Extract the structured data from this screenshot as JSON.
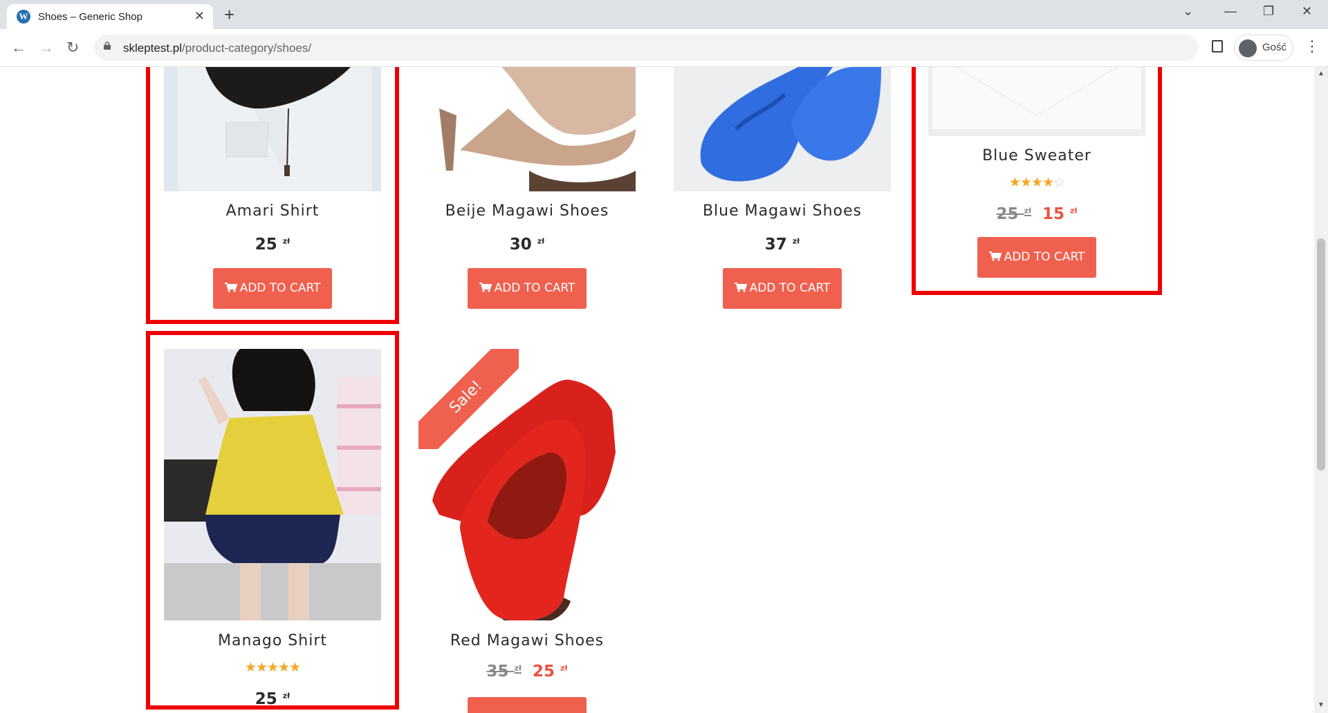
{
  "browser": {
    "tab_title": "Shoes – Generic Shop",
    "url_domain": "skleptest.pl",
    "url_path": "/product-category/shoes/",
    "profile_name": "Gość"
  },
  "products": [
    {
      "name": "Amari Shirt",
      "price": "25",
      "currency": "zł",
      "button": "ADD TO CART"
    },
    {
      "name": "Beije Magawi Shoes",
      "price": "30",
      "currency": "zł",
      "button": "ADD TO CART"
    },
    {
      "name": "Blue Magawi Shoes",
      "price": "37",
      "currency": "zł",
      "button": "ADD TO CART"
    },
    {
      "name": "Blue Sweater",
      "old_price": "25",
      "price": "15",
      "currency": "zł",
      "rating": 4,
      "button": "ADD TO CART"
    },
    {
      "name": "Manago Shirt",
      "price": "25",
      "currency": "zł",
      "rating": 5
    },
    {
      "name": "Red Magawi Shoes",
      "old_price": "35",
      "price": "25",
      "currency": "zł",
      "badge": "Sale!"
    }
  ],
  "colors": {
    "accent": "#f0604e",
    "highlight": "#e00000",
    "star": "#f5a623"
  }
}
